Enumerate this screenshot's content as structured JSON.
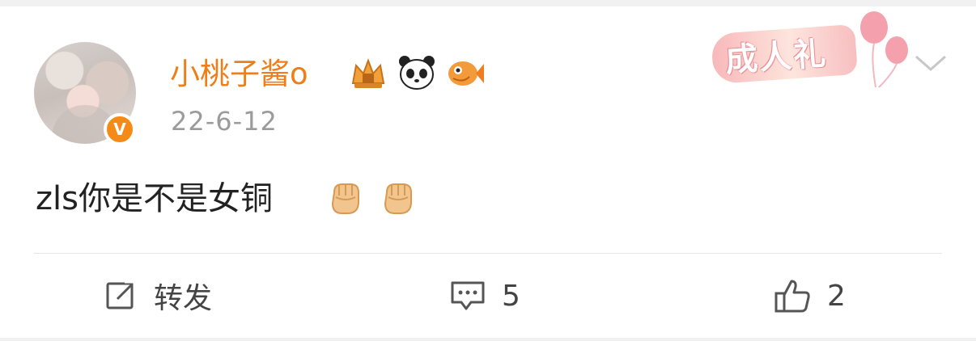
{
  "post": {
    "username": "小桃子酱o",
    "date": "22-6-12",
    "comment": "zls你是不是女铜",
    "verified_mark": "V",
    "ceremony_label": "成人礼"
  },
  "icons": {
    "badges": [
      "crown-badge-icon",
      "panda-badge-icon",
      "fish-badge-icon"
    ],
    "comment_emojis": [
      "fist-emoji",
      "fist-emoji"
    ],
    "menu": "chevron-down-icon"
  },
  "actions": {
    "repost_label": "转发",
    "comment_count": "5",
    "like_count": "2"
  },
  "colors": {
    "username": "#ef7e19",
    "verified_badge": "#f58b16",
    "secondary_text": "#9b9b9b",
    "main_text": "#222222"
  }
}
